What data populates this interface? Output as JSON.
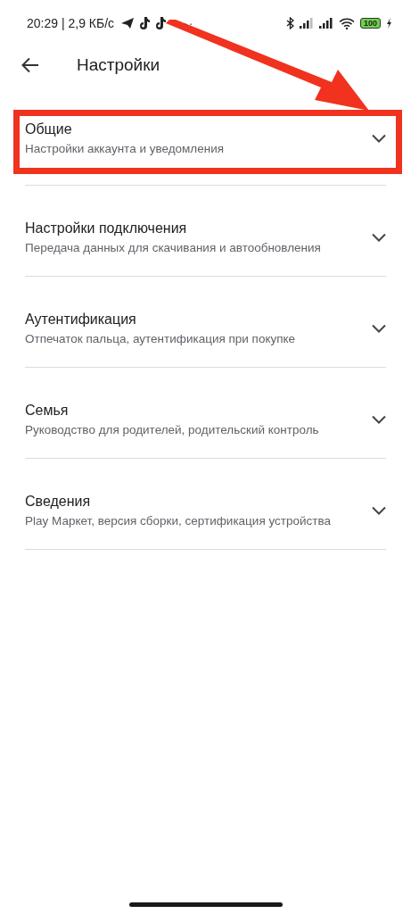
{
  "status_bar": {
    "time": "20:29 | 2,9 КБ/с",
    "more": "··",
    "battery": "100",
    "charging": true
  },
  "header": {
    "title": "Настройки"
  },
  "sections": [
    {
      "title": "Общие",
      "subtitle": "Настройки аккаунта и уведомления",
      "highlighted": true
    },
    {
      "title": "Настройки подключения",
      "subtitle": "Передача данных для скачивания и автообновления",
      "highlighted": false
    },
    {
      "title": "Аутентификация",
      "subtitle": "Отпечаток пальца, аутентификация при покупке",
      "highlighted": false
    },
    {
      "title": "Семья",
      "subtitle": "Руководство для родителей, родительский контроль",
      "highlighted": false
    },
    {
      "title": "Сведения",
      "subtitle": "Play Маркет, версия сборки, сертификация устройства",
      "highlighted": false
    }
  ],
  "annotation_arrow": true
}
